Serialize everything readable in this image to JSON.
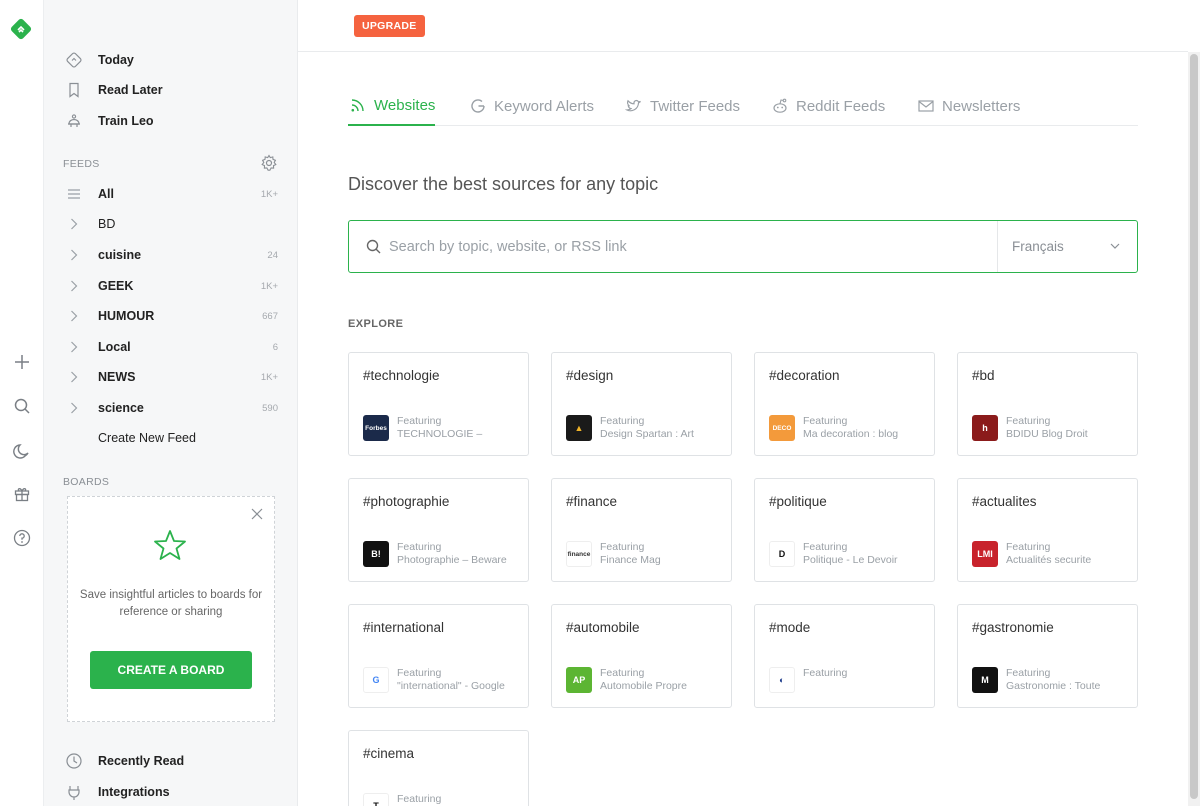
{
  "rail": {
    "brand_color": "#2bb24c",
    "icons": [
      "feedly-logo-icon",
      "plus-icon",
      "search-icon",
      "moon-icon",
      "gift-icon",
      "help-icon"
    ]
  },
  "sidebar": {
    "top_items": [
      {
        "label": "Today",
        "icon": "today-icon"
      },
      {
        "label": "Read Later",
        "icon": "bookmark-icon"
      },
      {
        "label": "Train Leo",
        "icon": "leo-icon"
      }
    ],
    "feeds_label": "FEEDS",
    "feeds": [
      {
        "name": "All",
        "count": "1K+"
      },
      {
        "name": "BD",
        "count": ""
      },
      {
        "name": "cuisine",
        "count": "24"
      },
      {
        "name": "GEEK",
        "count": "1K+"
      },
      {
        "name": "HUMOUR",
        "count": "667"
      },
      {
        "name": "Local",
        "count": "6"
      },
      {
        "name": "NEWS",
        "count": "1K+"
      },
      {
        "name": "science",
        "count": "590"
      }
    ],
    "create_feed": "Create New Feed",
    "boards_label": "BOARDS",
    "boards_text": "Save insightful articles to boards for reference or sharing",
    "create_board": "CREATE A BOARD",
    "bottom_items": [
      {
        "label": "Recently Read",
        "icon": "clock-icon"
      },
      {
        "label": "Integrations",
        "icon": "plug-icon"
      }
    ]
  },
  "main": {
    "upgrade": "UPGRADE",
    "tabs": [
      {
        "label": "Websites",
        "active": true
      },
      {
        "label": "Keyword Alerts",
        "active": false
      },
      {
        "label": "Twitter Feeds",
        "active": false
      },
      {
        "label": "Reddit Feeds",
        "active": false
      },
      {
        "label": "Newsletters",
        "active": false
      }
    ],
    "headline": "Discover the best sources for any topic",
    "search_placeholder": "Search by topic, website, or RSS link",
    "language": "Français",
    "explore": "EXPLORE",
    "featuring_label": "Featuring",
    "cards": [
      {
        "tag": "#technologie",
        "source": "TECHNOLOGIE –",
        "logo_text": "Forbes",
        "logo_bg": "#1b2a4a",
        "logo_fg": "#ffffff"
      },
      {
        "tag": "#design",
        "source": "Design Spartan : Art",
        "logo_text": "▲",
        "logo_bg": "#1a1a1a",
        "logo_fg": "#f0b429"
      },
      {
        "tag": "#decoration",
        "source": "Ma decoration : blog",
        "logo_text": "DECO",
        "logo_bg": "#f39a3b",
        "logo_fg": "#ffffff"
      },
      {
        "tag": "#bd",
        "source": "BDIDU Blog Droit",
        "logo_text": "h",
        "logo_bg": "#8b1b1b",
        "logo_fg": "#ffffff"
      },
      {
        "tag": "#photographie",
        "source": "Photographie – Beware",
        "logo_text": "B!",
        "logo_bg": "#111111",
        "logo_fg": "#ffffff"
      },
      {
        "tag": "#finance",
        "source": "Finance Mag",
        "logo_text": "finance",
        "logo_bg": "#ffffff",
        "logo_fg": "#333333"
      },
      {
        "tag": "#politique",
        "source": "Politique - Le Devoir",
        "logo_text": "D",
        "logo_bg": "#ffffff",
        "logo_fg": "#111111"
      },
      {
        "tag": "#actualites",
        "source": "Actualités securite",
        "logo_text": "LMI",
        "logo_bg": "#c8232c",
        "logo_fg": "#ffffff"
      },
      {
        "tag": "#international",
        "source": "\"international\" - Google",
        "logo_text": "G",
        "logo_bg": "#ffffff",
        "logo_fg": "#4285f4"
      },
      {
        "tag": "#automobile",
        "source": "Automobile Propre",
        "logo_text": "AP",
        "logo_bg": "#5cb533",
        "logo_fg": "#ffffff"
      },
      {
        "tag": "#mode",
        "source": "",
        "logo_text": "◐",
        "logo_bg": "#ffffff",
        "logo_fg": "#1b3a8a"
      },
      {
        "tag": "#gastronomie",
        "source": "Gastronomie : Toute",
        "logo_text": "M",
        "logo_bg": "#111111",
        "logo_fg": "#ffffff"
      },
      {
        "tag": "#cinema",
        "source": "",
        "logo_text": "T",
        "logo_bg": "#ffffff",
        "logo_fg": "#111111"
      }
    ]
  }
}
